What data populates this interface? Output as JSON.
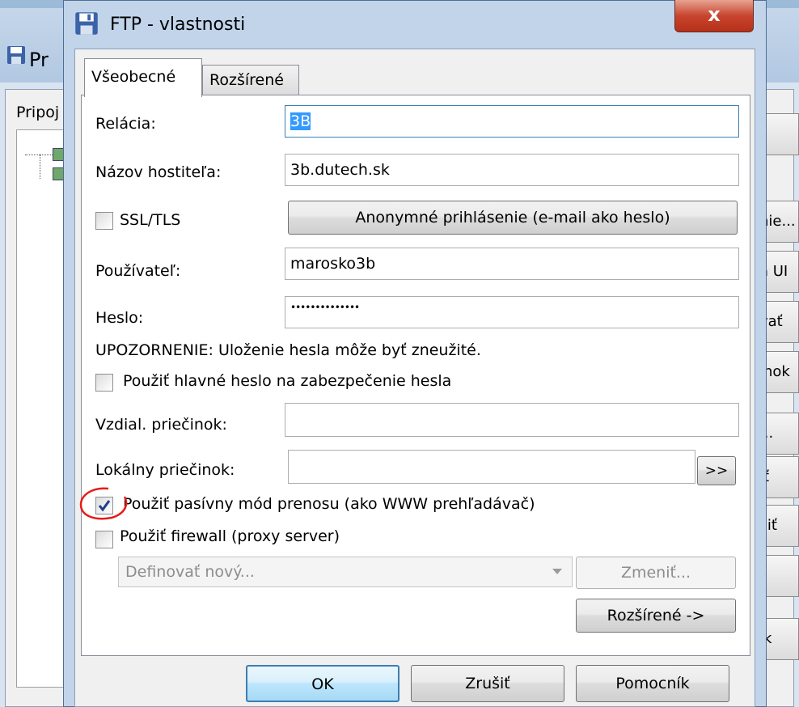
{
  "background_window": {
    "title_fragment": "Pr",
    "label_fragment": "Pripoj",
    "right_buttons": [
      "",
      "nie...",
      "a UI",
      "vať",
      "inok",
      "...",
      "iť",
      "čiť",
      "",
      "ík"
    ]
  },
  "dialog": {
    "title": "FTP - vlastnosti",
    "close_label": "x"
  },
  "tabs": [
    {
      "label": "Všeobecné"
    },
    {
      "label": "Rozšírené"
    }
  ],
  "form": {
    "session_label": "Relácia:",
    "session_value": "3B",
    "hostname_label": "Názov hostiteľa:",
    "hostname_value": "3b.dutech.sk",
    "ssl_label": "SSL/TLS",
    "anonymous_button": "Anonymné prihlásenie (e-mail ako heslo)",
    "user_label": "Používateľ:",
    "user_value": "marosko3b",
    "password_label": "Heslo:",
    "password_value": "••••••••••••••",
    "warning_text": "UPOZORNENIE: Uloženie hesla môže byť zneužité.",
    "master_password_label": "Použiť hlavné heslo na zabezpečenie hesla",
    "remote_folder_label": "Vzdial. priečinok:",
    "remote_folder_value": "",
    "local_folder_label": "Lokálny priečinok:",
    "local_folder_value": "",
    "browse_button": ">>",
    "passive_mode_label": "Použiť pasívny mód prenosu (ako WWW prehľadávač)",
    "passive_mode_checked": true,
    "firewall_label": "Použiť firewall (proxy server)",
    "firewall_checked": false,
    "proxy_select_value": "Definovať nový...",
    "change_button": "Zmeniť...",
    "advanced_button": "Rozšírené ->"
  },
  "footer": {
    "ok": "OK",
    "cancel": "Zrušiť",
    "help": "Pomocník"
  }
}
